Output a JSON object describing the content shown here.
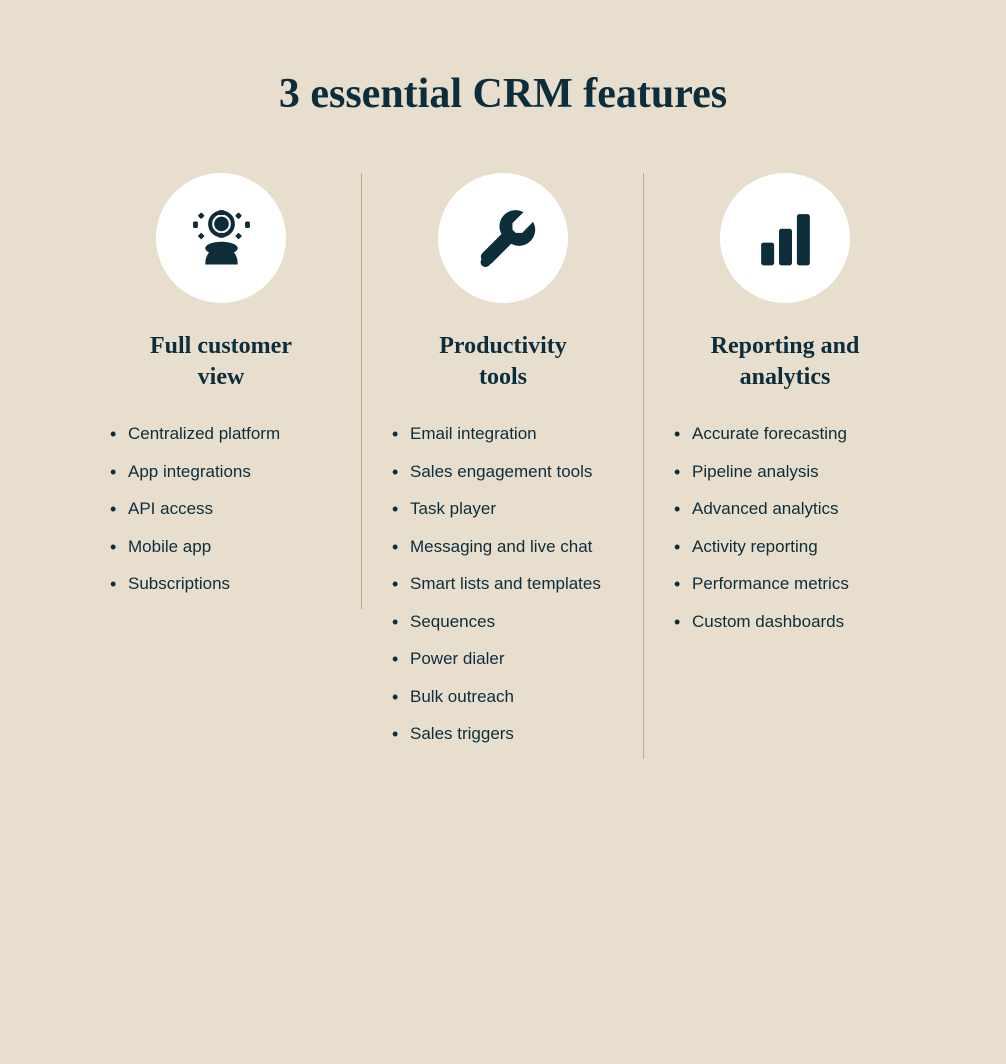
{
  "page": {
    "background_color": "#e8dece",
    "title": "3 essential CRM features"
  },
  "columns": [
    {
      "id": "customer-view",
      "icon": "person",
      "title": "Full customer view",
      "items": [
        "Centralized platform",
        "App integrations",
        "API access",
        "Mobile app",
        "Subscriptions"
      ]
    },
    {
      "id": "productivity-tools",
      "icon": "wrench",
      "title": "Productivity tools",
      "items": [
        "Email integration",
        "Sales engagement tools",
        "Task player",
        "Messaging and live chat",
        "Smart lists and templates",
        "Sequences",
        "Power dialer",
        "Bulk outreach",
        "Sales triggers"
      ]
    },
    {
      "id": "reporting-analytics",
      "icon": "chart",
      "title": "Reporting and analytics",
      "items": [
        "Accurate forecasting",
        "Pipeline analysis",
        "Advanced analytics",
        "Activity reporting",
        "Performance metrics",
        "Custom dashboards"
      ]
    }
  ]
}
